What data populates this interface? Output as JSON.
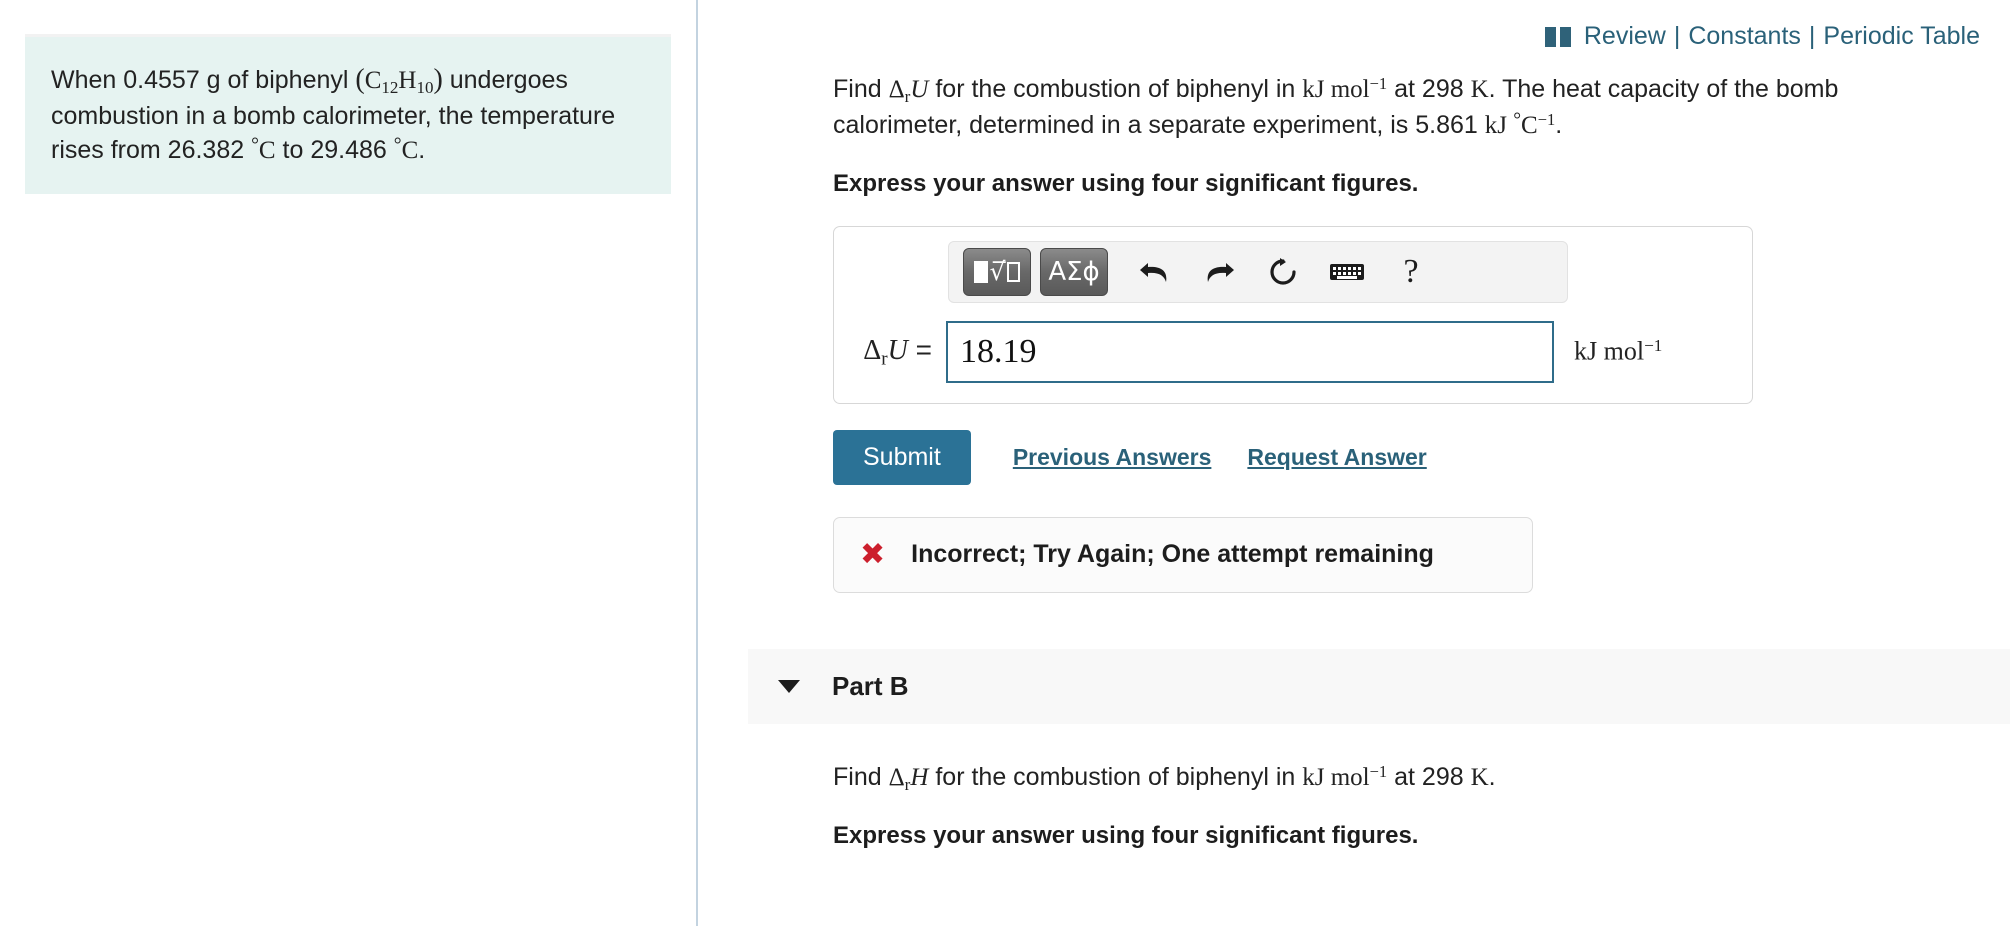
{
  "top_nav": {
    "book_icon": "open-book-icon",
    "links": [
      "Review",
      "Constants",
      "Periodic Table"
    ],
    "separator": "|",
    "link_color": "#2a6179"
  },
  "problem_statement": {
    "line1_a": "When 0.4557 g of biphenyl ",
    "formula_open": "(",
    "formula_C": "C",
    "formula_C_sub": "12",
    "formula_H": "H",
    "formula_H_sub": "10",
    "formula_close": ")",
    "line1_b": " undergoes combustion in a bomb calorimeter, the temperature rises from 26.382 ",
    "deg1": "°",
    "unit1": "C",
    "mid": " to 29.486 ",
    "deg2": "°",
    "unit2": "C",
    "end": ".",
    "background_color": "#e6f3f1"
  },
  "part_a": {
    "question_pre": "Find ",
    "delta": "Δ",
    "delta_sub": "r",
    "symbol": "U",
    "question_mid": " for the combustion of biphenyl in ",
    "unit_kj": "kJ mol",
    "unit_exp": "−1",
    "question_temp": " at 298 ",
    "kelvin": "K",
    "question_tail": ". The heat capacity of the bomb calorimeter, determined in a separate experiment, is 5.861 ",
    "hc_unit_kj": "kJ ",
    "hc_unit_deg": "°",
    "hc_unit_c": "C",
    "hc_unit_exp": "−1",
    "question_end": ".",
    "instruction": "Express your answer using four significant figures.",
    "toolbar": {
      "template_button": "math-template-button",
      "greek_button_label": "ΑΣϕ",
      "undo": "undo-icon",
      "redo": "redo-icon",
      "reset": "reset-icon",
      "keyboard": "keyboard-icon",
      "help_label": "?"
    },
    "answer": {
      "label_delta": "Δ",
      "label_sub": "r",
      "label_symbol": "U",
      "label_equals": "=",
      "value": "18.19",
      "placeholder": "",
      "unit_base": "kJ mol",
      "unit_exp": "−1",
      "border_color": "#2f6c8a"
    },
    "submit_label": "Submit",
    "submit_color": "#2b7296",
    "previous_answers_label": "Previous Answers",
    "request_answer_label": "Request Answer",
    "feedback": {
      "icon": "red-x-icon",
      "icon_glyph": "✖",
      "icon_color": "#cc1f2d",
      "text": "Incorrect; Try Again; One attempt remaining"
    }
  },
  "part_b": {
    "caret": "caret-down-icon",
    "title": "Part B",
    "question_pre": "Find ",
    "delta": "Δ",
    "delta_sub": "r",
    "symbol": "H",
    "question_mid": " for the combustion of biphenyl in ",
    "unit_kj": "kJ mol",
    "unit_exp": "−1",
    "question_temp": " at 298 ",
    "kelvin": "K",
    "question_end": ".",
    "instruction": "Express your answer using four significant figures."
  }
}
